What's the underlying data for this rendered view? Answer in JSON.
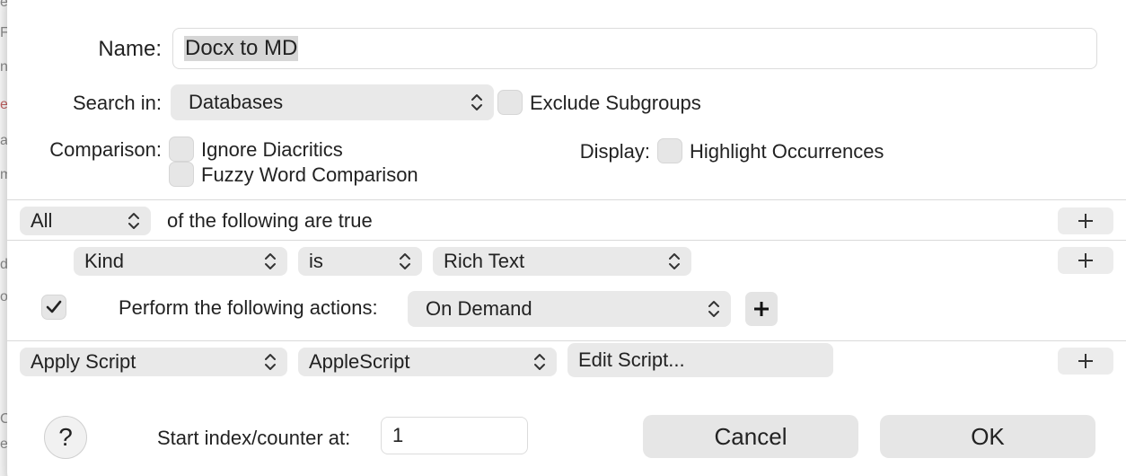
{
  "dialog": {
    "name_label": "Name:",
    "name_value": "Docx to MD",
    "search_in_label": "Search in:",
    "search_in_value": "Databases",
    "exclude_subgroups_label": "Exclude Subgroups",
    "exclude_subgroups_checked": false,
    "comparison_label": "Comparison:",
    "ignore_diacritics_label": "Ignore Diacritics",
    "fuzzy_word_label": "Fuzzy Word Comparison",
    "display_label": "Display:",
    "highlight_label": "Highlight Occurrences"
  },
  "conditions": {
    "match_value": "All",
    "match_suffix": "of the following are true",
    "rule": {
      "field": "Kind",
      "operator": "is",
      "value": "Rich Text"
    }
  },
  "actions": {
    "perform_checked": true,
    "perform_label": "Perform the following actions:",
    "trigger_value": "On Demand",
    "action": {
      "type": "Apply Script",
      "language": "AppleScript",
      "edit_label": "Edit Script..."
    }
  },
  "footer": {
    "help_label": "?",
    "start_index_label": "Start index/counter at:",
    "start_index_value": "1",
    "cancel_label": "Cancel",
    "ok_label": "OK"
  },
  "icons": {
    "popup_arrows": "chevron-up-down-icon",
    "add": "plus-icon",
    "check": "checkmark-icon"
  },
  "background_window_fragments": [
    "ery",
    "F",
    "n",
    "er",
    "ar",
    "m",
    "d",
    "ol",
    "C",
    "er"
  ]
}
